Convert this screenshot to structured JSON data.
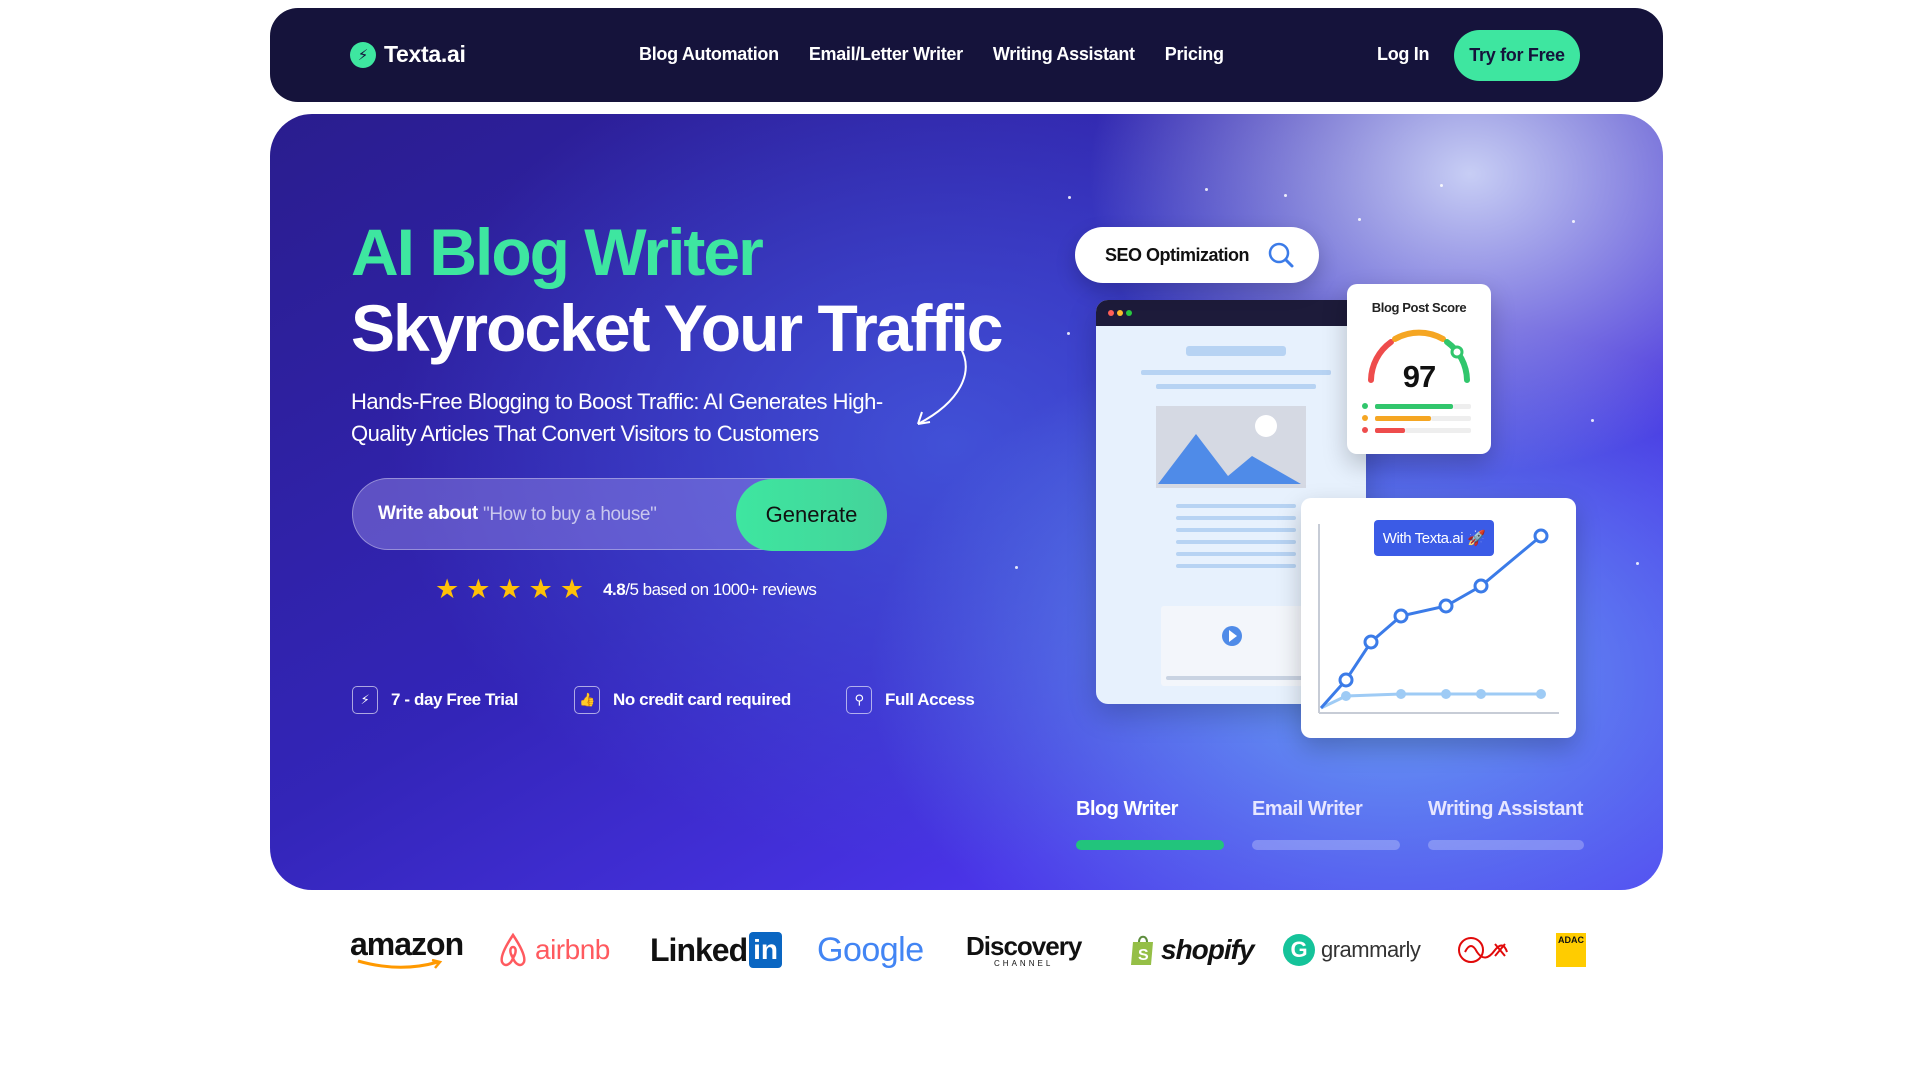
{
  "nav": {
    "logo_text": "Texta.ai",
    "links": [
      "Blog Automation",
      "Email/Letter Writer",
      "Writing Assistant",
      "Pricing"
    ],
    "login_label": "Log In",
    "cta_label": "Try for Free"
  },
  "hero": {
    "title_line1": "AI Blog Writer",
    "title_line2": "Skyrocket Your Traffic",
    "subtitle": "Hands-Free Blogging to Boost Traffic: AI Generates High-Quality Articles That Convert Visitors to Customers",
    "search": {
      "label": "Write about",
      "placeholder": "\"How to buy a house\"",
      "button_label": "Generate"
    },
    "rating": {
      "stars": 5,
      "score": "4.8",
      "suffix": "/5 based on 1000+ reviews"
    },
    "features": [
      {
        "label": "7 - day Free Trial",
        "icon": "lightning-icon"
      },
      {
        "label": "No credit card required",
        "icon": "thumbs-up-icon"
      },
      {
        "label": "Full Access",
        "icon": "lock-icon"
      }
    ]
  },
  "illustration": {
    "seo_pill_label": "SEO Optimization",
    "score_card_title": "Blog Post Score",
    "score_value": "97",
    "chart_badge": "With Texta.ai 🚀"
  },
  "tabs": [
    {
      "label": "Blog Writer",
      "active": true
    },
    {
      "label": "Email Writer",
      "active": false
    },
    {
      "label": "Writing Assistant",
      "active": false
    }
  ],
  "logos": [
    "amazon",
    "airbnb",
    "Linked",
    "in",
    "Google",
    "Discovery",
    "CHANNEL",
    "shopify",
    "grammarly",
    "ADAC"
  ],
  "colors": {
    "nav_bg": "#15133b",
    "accent_green": "#3ee6a0",
    "hero_purple": "#3325b8",
    "badge_blue": "#3b5be6",
    "star_yellow": "#ffc107"
  }
}
